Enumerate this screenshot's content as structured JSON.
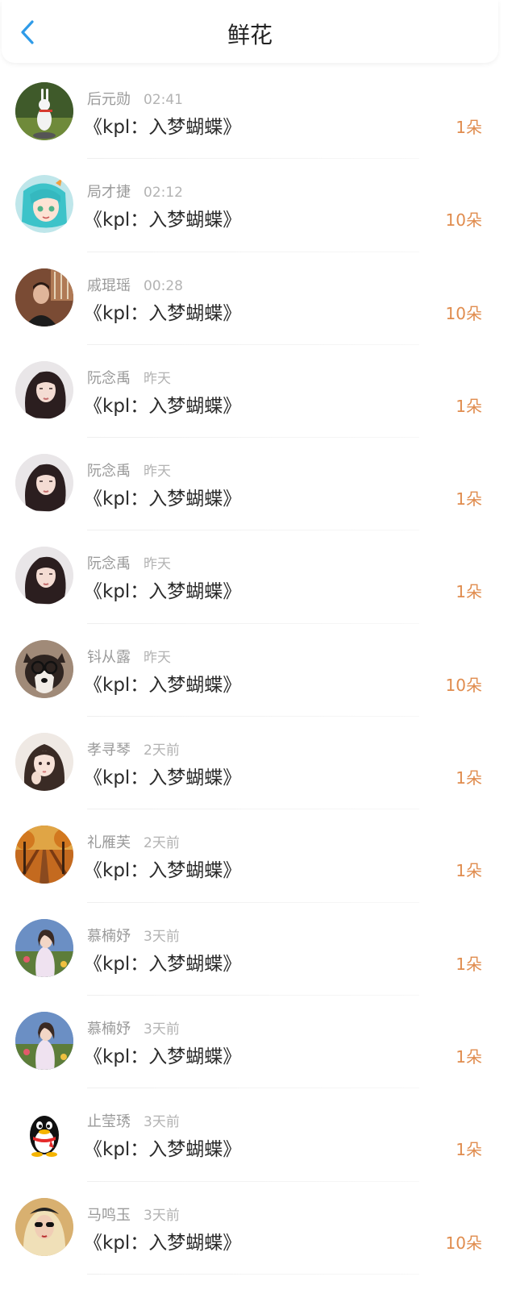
{
  "header": {
    "title": "鲜花"
  },
  "items": [
    {
      "name": "后元勋",
      "time": "02:41",
      "work": "《kpl：入梦蝴蝶》",
      "count": "1朵",
      "avatar": "rabbit-statue"
    },
    {
      "name": "局才捷",
      "time": "02:12",
      "work": "《kpl：入梦蝴蝶》",
      "count": "10朵",
      "avatar": "anime-girl"
    },
    {
      "name": "戚琨瑶",
      "time": "00:28",
      "work": "《kpl：入梦蝴蝶》",
      "count": "10朵",
      "avatar": "man-portrait"
    },
    {
      "name": "阮念禹",
      "time": "昨天",
      "work": "《kpl：入梦蝴蝶》",
      "count": "1朵",
      "avatar": "woman-portrait"
    },
    {
      "name": "阮念禹",
      "time": "昨天",
      "work": "《kpl：入梦蝴蝶》",
      "count": "1朵",
      "avatar": "woman-portrait"
    },
    {
      "name": "阮念禹",
      "time": "昨天",
      "work": "《kpl：入梦蝴蝶》",
      "count": "1朵",
      "avatar": "woman-portrait"
    },
    {
      "name": "钭从露",
      "time": "昨天",
      "work": "《kpl：入梦蝴蝶》",
      "count": "10朵",
      "avatar": "dog-with-glasses"
    },
    {
      "name": "孝寻琴",
      "time": "2天前",
      "work": "《kpl：入梦蝴蝶》",
      "count": "1朵",
      "avatar": "girl-portrait"
    },
    {
      "name": "礼雁芙",
      "time": "2天前",
      "work": "《kpl：入梦蝴蝶》",
      "count": "1朵",
      "avatar": "autumn-road"
    },
    {
      "name": "慕楠妤",
      "time": "3天前",
      "work": "《kpl：入梦蝴蝶》",
      "count": "1朵",
      "avatar": "woman-outdoor"
    },
    {
      "name": "慕楠妤",
      "time": "3天前",
      "work": "《kpl：入梦蝴蝶》",
      "count": "1朵",
      "avatar": "woman-outdoor"
    },
    {
      "name": "止莹琇",
      "time": "3天前",
      "work": "《kpl：入梦蝴蝶》",
      "count": "1朵",
      "avatar": "qq-penguin"
    },
    {
      "name": "马鸣玉",
      "time": "3天前",
      "work": "《kpl：入梦蝴蝶》",
      "count": "10朵",
      "avatar": "woman-sunglasses"
    }
  ],
  "colors": {
    "accent": "#2f9be8",
    "count": "#e08c4e"
  },
  "icons": {
    "back": "chevron-left-icon"
  }
}
